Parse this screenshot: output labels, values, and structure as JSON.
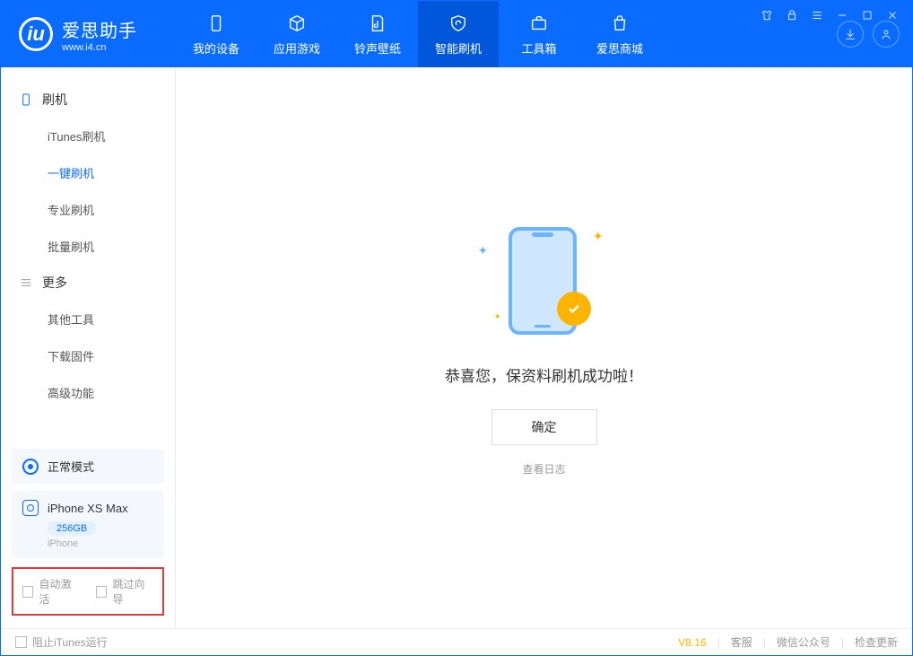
{
  "app": {
    "title": "爱思助手",
    "subtitle": "www.i4.cn",
    "logo_letter": "iu"
  },
  "nav": {
    "tabs": [
      {
        "label": "我的设备"
      },
      {
        "label": "应用游戏"
      },
      {
        "label": "铃声壁纸"
      },
      {
        "label": "智能刷机"
      },
      {
        "label": "工具箱"
      },
      {
        "label": "爱思商城"
      }
    ]
  },
  "sidebar": {
    "group1": {
      "title": "刷机",
      "items": [
        "iTunes刷机",
        "一键刷机",
        "专业刷机",
        "批量刷机"
      ]
    },
    "group2": {
      "title": "更多",
      "items": [
        "其他工具",
        "下载固件",
        "高级功能"
      ]
    },
    "status": {
      "label": "正常模式"
    },
    "device": {
      "name": "iPhone XS Max",
      "storage": "256GB",
      "type": "iPhone"
    },
    "checkboxes": {
      "auto_activate": "自动激活",
      "skip_guide": "跳过向导"
    }
  },
  "main": {
    "success_msg": "恭喜您，保资料刷机成功啦！",
    "ok_button": "确定",
    "view_log": "查看日志"
  },
  "footer": {
    "block_itunes": "阻止iTunes运行",
    "version": "V8.16",
    "links": [
      "客服",
      "微信公众号",
      "检查更新"
    ]
  }
}
